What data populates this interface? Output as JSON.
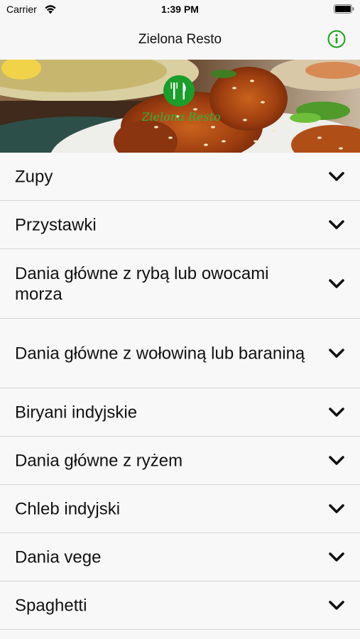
{
  "status_bar": {
    "carrier": "Carrier",
    "time": "1:39 PM",
    "icons": [
      "wifi-icon",
      "battery-icon"
    ]
  },
  "nav": {
    "title": "Zielona Resto",
    "info_icon": "info-icon",
    "accent_color": "#1aa31a"
  },
  "banner": {
    "logo_text": "Zielona Resto",
    "logo_icon": "fork-knife-icon"
  },
  "menu": {
    "items": [
      {
        "label": "Zupy"
      },
      {
        "label": "Przystawki"
      },
      {
        "label": "Dania główne z rybą lub owocami morza"
      },
      {
        "label": "Dania główne z wołowiną lub baraniną"
      },
      {
        "label": "Biryani indyjskie"
      },
      {
        "label": "Dania główne z ryżem"
      },
      {
        "label": "Chleb indyjski"
      },
      {
        "label": "Dania vege"
      },
      {
        "label": "Spaghetti"
      }
    ],
    "row_icon": "chevron-down-icon"
  }
}
